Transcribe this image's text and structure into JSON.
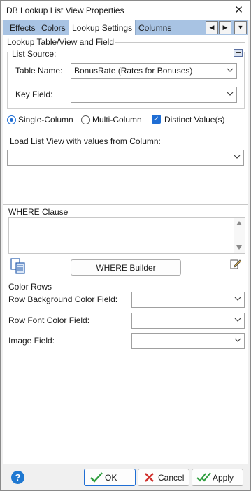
{
  "window": {
    "title": "DB Lookup List View Properties",
    "close_glyph": "✕"
  },
  "tabs": [
    {
      "label": "Effects"
    },
    {
      "label": "Colors"
    },
    {
      "label": "Lookup Settings"
    },
    {
      "label": "Columns"
    }
  ],
  "tab_nav": {
    "prev": "◀",
    "next": "▶",
    "menu": "▼"
  },
  "lookup": {
    "group_title": "Lookup Table/View and Field",
    "list_source": {
      "title": "List Source:",
      "table_name_label": "Table Name:",
      "table_name_value": "BonusRate  (Rates for Bonuses)",
      "key_field_label": "Key Field:",
      "key_field_value": ""
    },
    "options": {
      "single_column": "Single-Column",
      "multi_column": "Multi-Column",
      "distinct_values": "Distinct Value(s)"
    },
    "load_label": "Load List View with values from Column:",
    "load_value": ""
  },
  "where": {
    "title": "WHERE Clause",
    "text": "",
    "builder_button": "WHERE Builder"
  },
  "color_rows": {
    "title": "Color Rows",
    "row_bg_label": "Row Background Color Field:",
    "row_font_label": "Row Font Color Field:",
    "image_label": "Image Field:"
  },
  "footer": {
    "help_glyph": "?",
    "ok_label": "OK",
    "cancel_label": "Cancel",
    "apply_label": "Apply"
  },
  "colors": {
    "tab_strip": "#a8c3e3",
    "accent": "#1f6ed4",
    "ok_check": "#2e9e3e",
    "cancel_x": "#d0312d"
  }
}
